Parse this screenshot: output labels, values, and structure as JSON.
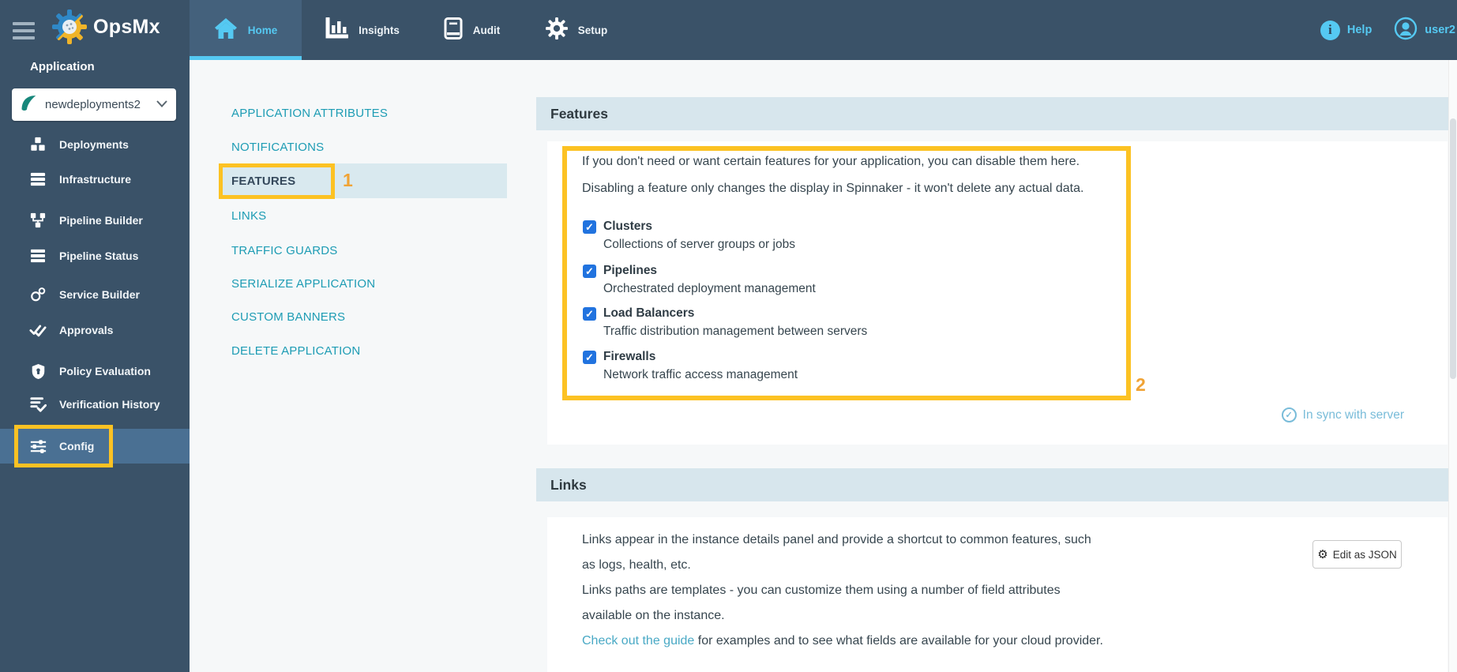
{
  "topbar": {
    "brand": "OpsMx",
    "tabs": [
      {
        "label": "Home",
        "active": true
      },
      {
        "label": "Insights",
        "active": false
      },
      {
        "label": "Audit",
        "active": false
      },
      {
        "label": "Setup",
        "active": false
      }
    ],
    "help_label": "Help",
    "user_label": "user2"
  },
  "sidebar": {
    "section_label": "Application",
    "app_selector_value": "newdeployments2",
    "items": [
      {
        "label": "Deployments",
        "active": false
      },
      {
        "label": "Infrastructure",
        "active": false
      },
      {
        "label": "Pipeline Builder",
        "active": false
      },
      {
        "label": "Pipeline Status",
        "active": false
      },
      {
        "label": "Service Builder",
        "active": false
      },
      {
        "label": "Approvals",
        "active": false
      },
      {
        "label": "Policy Evaluation",
        "active": false
      },
      {
        "label": "Verification History",
        "active": false
      },
      {
        "label": "Config",
        "active": true
      }
    ]
  },
  "config_nav": {
    "items": [
      {
        "label": "APPLICATION ATTRIBUTES",
        "active": false
      },
      {
        "label": "NOTIFICATIONS",
        "active": false
      },
      {
        "label": "FEATURES",
        "active": true
      },
      {
        "label": "LINKS",
        "active": false
      },
      {
        "label": "TRAFFIC GUARDS",
        "active": false
      },
      {
        "label": "SERIALIZE APPLICATION",
        "active": false
      },
      {
        "label": "CUSTOM BANNERS",
        "active": false
      },
      {
        "label": "DELETE APPLICATION",
        "active": false
      }
    ]
  },
  "features_section": {
    "title": "Features",
    "intro1": "If you don't need or want certain features for your application, you can disable them here.",
    "intro2": "Disabling a feature only changes the display in Spinnaker - it won't delete any actual data.",
    "features": [
      {
        "name": "Clusters",
        "desc": "Collections of server groups or jobs",
        "checked": true
      },
      {
        "name": "Pipelines",
        "desc": "Orchestrated deployment management",
        "checked": true
      },
      {
        "name": "Load Balancers",
        "desc": "Traffic distribution management between servers",
        "checked": true
      },
      {
        "name": "Firewalls",
        "desc": "Network traffic access management",
        "checked": true
      }
    ],
    "check_glyph": "✓",
    "sync_status": "In sync with server"
  },
  "links_section": {
    "title": "Links",
    "p1": "Links appear in the instance details panel and provide a shortcut to common features, such as logs, health, etc.",
    "p2": "Links paths are templates - you can customize them using a number of field attributes available on the instance.",
    "p3_link": "Check out the guide",
    "p3_rest": " for examples and to see what fields are available for your cloud provider.",
    "edit_button": "Edit as JSON",
    "edit_button_icon": "⚙"
  },
  "annotations": {
    "one": "1",
    "two": "2"
  },
  "colors": {
    "topbar_bg": "#3a5268",
    "active_tab_underline": "#55c9f2",
    "sidebar_active_row": "#4a7093",
    "nav_teal": "#1d9cb4",
    "section_header_bg": "#d7e6ed",
    "annotation_yellow": "#fcc223",
    "annotation_orange": "#f0a335",
    "checkbox_blue": "#2173df",
    "sync_teal": "#79bcd9"
  }
}
